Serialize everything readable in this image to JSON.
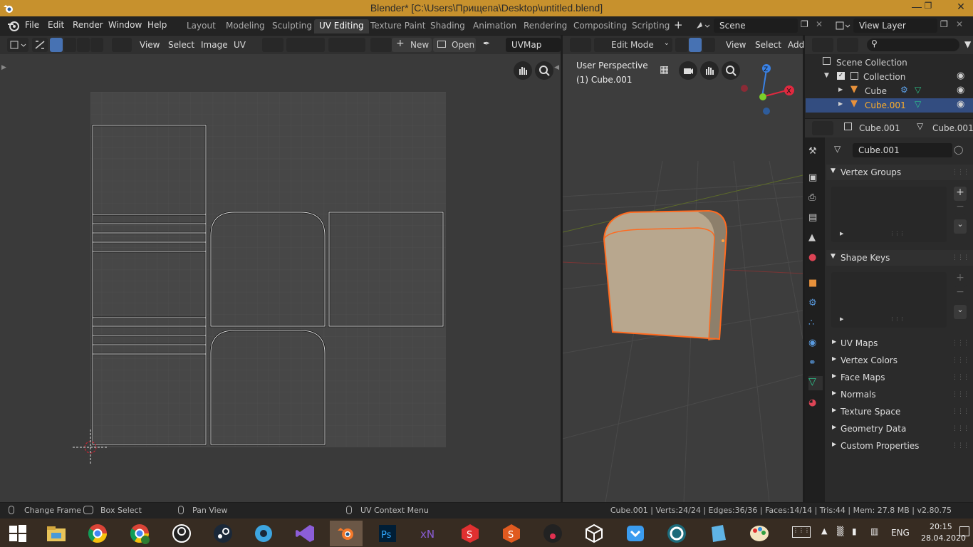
{
  "window": {
    "title": "Blender* [C:\\Users\\Прищепа\\Desktop\\untitled.blend]"
  },
  "menu": [
    "File",
    "Edit",
    "Render",
    "Window",
    "Help"
  ],
  "workspaces": [
    "Layout",
    "Modeling",
    "Sculpting",
    "UV Editing",
    "Texture Paint",
    "Shading",
    "Animation",
    "Rendering",
    "Compositing",
    "Scripting"
  ],
  "scene": {
    "name": "Scene",
    "view_layer": "View Layer"
  },
  "uv_editor": {
    "menus": [
      "View",
      "Select",
      "Image",
      "UV"
    ],
    "new_label": "New",
    "open_label": "Open",
    "uvmap": "UVMap"
  },
  "viewport": {
    "mode": "Edit Mode",
    "menus": [
      "View",
      "Select",
      "Add"
    ],
    "perspective": "User Perspective",
    "object": "(1) Cube.001",
    "axes": {
      "z": "Z",
      "x": "X",
      "y": "Y"
    },
    "colors": {
      "x": "#e0293f",
      "y": "#7bcf2a",
      "z": "#3a82e6"
    }
  },
  "outliner": {
    "scene_collection": "Scene Collection",
    "collection": "Collection",
    "objects": [
      "Cube",
      "Cube.001"
    ]
  },
  "properties": {
    "object_name": "Cube.001",
    "mesh_name": "Cube.001",
    "data_field": "Cube.001",
    "sections": {
      "vertex_groups": "Vertex Groups",
      "shape_keys": "Shape Keys",
      "collapsed": [
        "UV Maps",
        "Vertex Colors",
        "Face Maps",
        "Normals",
        "Texture Space",
        "Geometry Data",
        "Custom Properties"
      ]
    }
  },
  "statusbar": {
    "left": [
      "Change Frame",
      "Box Select",
      "Pan View",
      "UV Context Menu"
    ],
    "stats": "Cube.001 | Verts:24/24 | Edges:36/36 | Faces:14/14 | Tris:44 | Mem: 27.8 MB | v2.80.75"
  },
  "taskbar": {
    "time": "20:15",
    "date": "28.04.2020",
    "lang": "ENG"
  }
}
